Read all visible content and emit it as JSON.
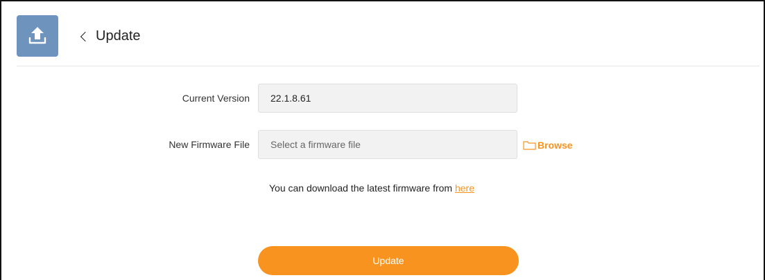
{
  "header": {
    "icon": "upload-icon",
    "back_label": "Update"
  },
  "form": {
    "current_version": {
      "label": "Current Version",
      "value": "22.1.8.61"
    },
    "firmware_file": {
      "label": "New Firmware File",
      "placeholder": "Select a firmware file",
      "browse_label": "Browse",
      "browse_icon": "folder-icon"
    },
    "hint": {
      "text": "You can download the latest firmware from ",
      "link_label": "here"
    },
    "submit_label": "Update"
  },
  "colors": {
    "accent": "#f7931e",
    "icon_bg": "#6e93bd",
    "field_bg": "#f2f2f2"
  }
}
